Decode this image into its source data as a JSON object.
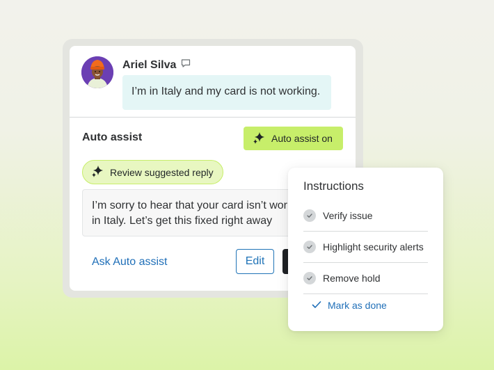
{
  "conversation": {
    "sender_name": "Ariel Silva",
    "message": "I’m in Italy and my card is not working.",
    "icons": {
      "avatar": "avatar-photo",
      "message_type": "chat-bubble-icon"
    }
  },
  "auto_assist": {
    "title": "Auto assist",
    "toggle_label": "Auto assist on",
    "review_label": "Review suggested reply",
    "suggested_reply": "I’m sorry to hear that your card isn’t wor\nin Italy. Let’s get this fixed right away",
    "ask_link": "Ask Auto assist",
    "edit_label": "Edit",
    "sparkle_icon": "sparkle-icon"
  },
  "instructions": {
    "title": "Instructions",
    "items": [
      {
        "label": "Verify issue"
      },
      {
        "label": "Highlight security alerts"
      },
      {
        "label": "Remove hold"
      }
    ],
    "mark_done_label": "Mark as done"
  },
  "colors": {
    "accent_green": "#c7ee6a",
    "light_green": "#e8f7c1",
    "bubble_teal": "#e4f6f6",
    "link_blue": "#1f6fb8",
    "dark_button": "#1f2225"
  }
}
